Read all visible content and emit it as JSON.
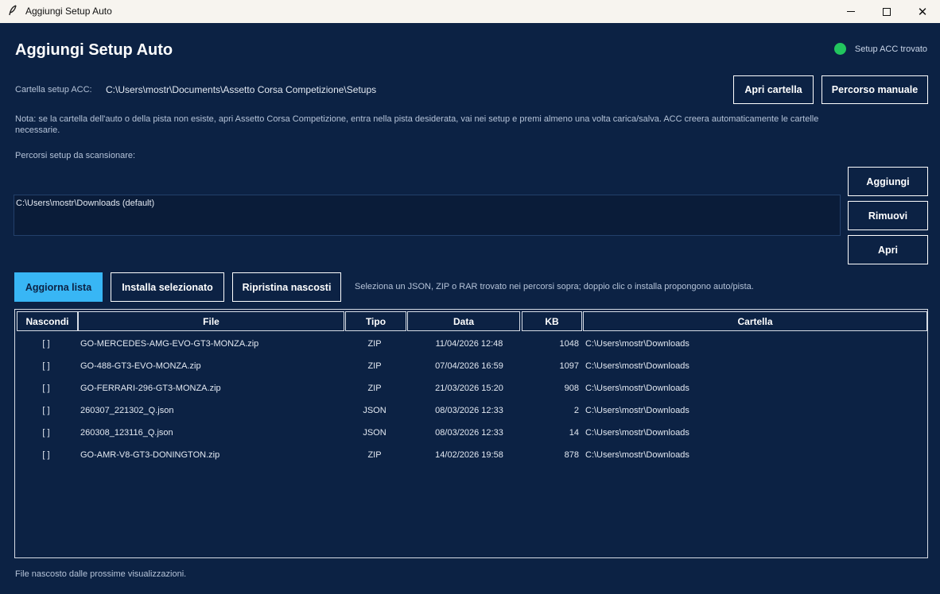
{
  "window": {
    "title": "Aggiungi Setup Auto",
    "minimize": "",
    "maximize": "",
    "close": "✕",
    "app_icon": "feather-icon"
  },
  "header": {
    "title": "Aggiungi Setup Auto",
    "status_text": "Setup ACC trovato",
    "status_color": "#22c55e"
  },
  "acc_folder": {
    "label": "Cartella setup ACC:",
    "value": "C:\\Users\\mostr\\Documents\\Assetto Corsa Competizione\\Setups",
    "open_button": "Apri cartella",
    "manual_button": "Percorso manuale"
  },
  "note": "Nota: se la cartella dell'auto o della pista non esiste, apri Assetto Corsa Competizione, entra nella pista desiderata, vai nei setup e premi almeno una volta carica/salva. ACC creera automaticamente le cartelle necessarie.",
  "scan_paths": {
    "label": "Percorsi setup da scansionare:",
    "items": [
      "C:\\Users\\mostr\\Downloads  (default)"
    ],
    "add_button": "Aggiungi",
    "remove_button": "Rimuovi",
    "open_button": "Apri"
  },
  "actions": {
    "refresh_button": "Aggiorna lista",
    "install_button": "Installa selezionato",
    "restore_button": "Ripristina nascosti",
    "hint": "Seleziona un JSON, ZIP o RAR trovato nei percorsi sopra; doppio clic o installa propongono auto/pista."
  },
  "table": {
    "columns": [
      "Nascondi",
      "File",
      "Tipo",
      "Data",
      "KB",
      "Cartella"
    ],
    "rows": [
      {
        "hide": "[ ]",
        "file": "GO-MERCEDES-AMG-EVO-GT3-MONZA.zip",
        "type": "ZIP",
        "date": "11/04/2026 12:48",
        "kb": "1048",
        "folder": "C:\\Users\\mostr\\Downloads"
      },
      {
        "hide": "[ ]",
        "file": "GO-488-GT3-EVO-MONZA.zip",
        "type": "ZIP",
        "date": "07/04/2026 16:59",
        "kb": "1097",
        "folder": "C:\\Users\\mostr\\Downloads"
      },
      {
        "hide": "[ ]",
        "file": "GO-FERRARI-296-GT3-MONZA.zip",
        "type": "ZIP",
        "date": "21/03/2026 15:20",
        "kb": "908",
        "folder": "C:\\Users\\mostr\\Downloads"
      },
      {
        "hide": "[ ]",
        "file": "260307_221302_Q.json",
        "type": "JSON",
        "date": "08/03/2026 12:33",
        "kb": "2",
        "folder": "C:\\Users\\mostr\\Downloads"
      },
      {
        "hide": "[ ]",
        "file": "260308_123116_Q.json",
        "type": "JSON",
        "date": "08/03/2026 12:33",
        "kb": "14",
        "folder": "C:\\Users\\mostr\\Downloads"
      },
      {
        "hide": "[ ]",
        "file": "GO-AMR-V8-GT3-DONINGTON.zip",
        "type": "ZIP",
        "date": "14/02/2026 19:58",
        "kb": "878",
        "folder": "C:\\Users\\mostr\\Downloads"
      }
    ]
  },
  "footer": "File nascosto dalle prossime visualizzazioni.",
  "colors": {
    "background": "#0c2244",
    "accent": "#38b6f5",
    "status_ok": "#22c55e"
  }
}
